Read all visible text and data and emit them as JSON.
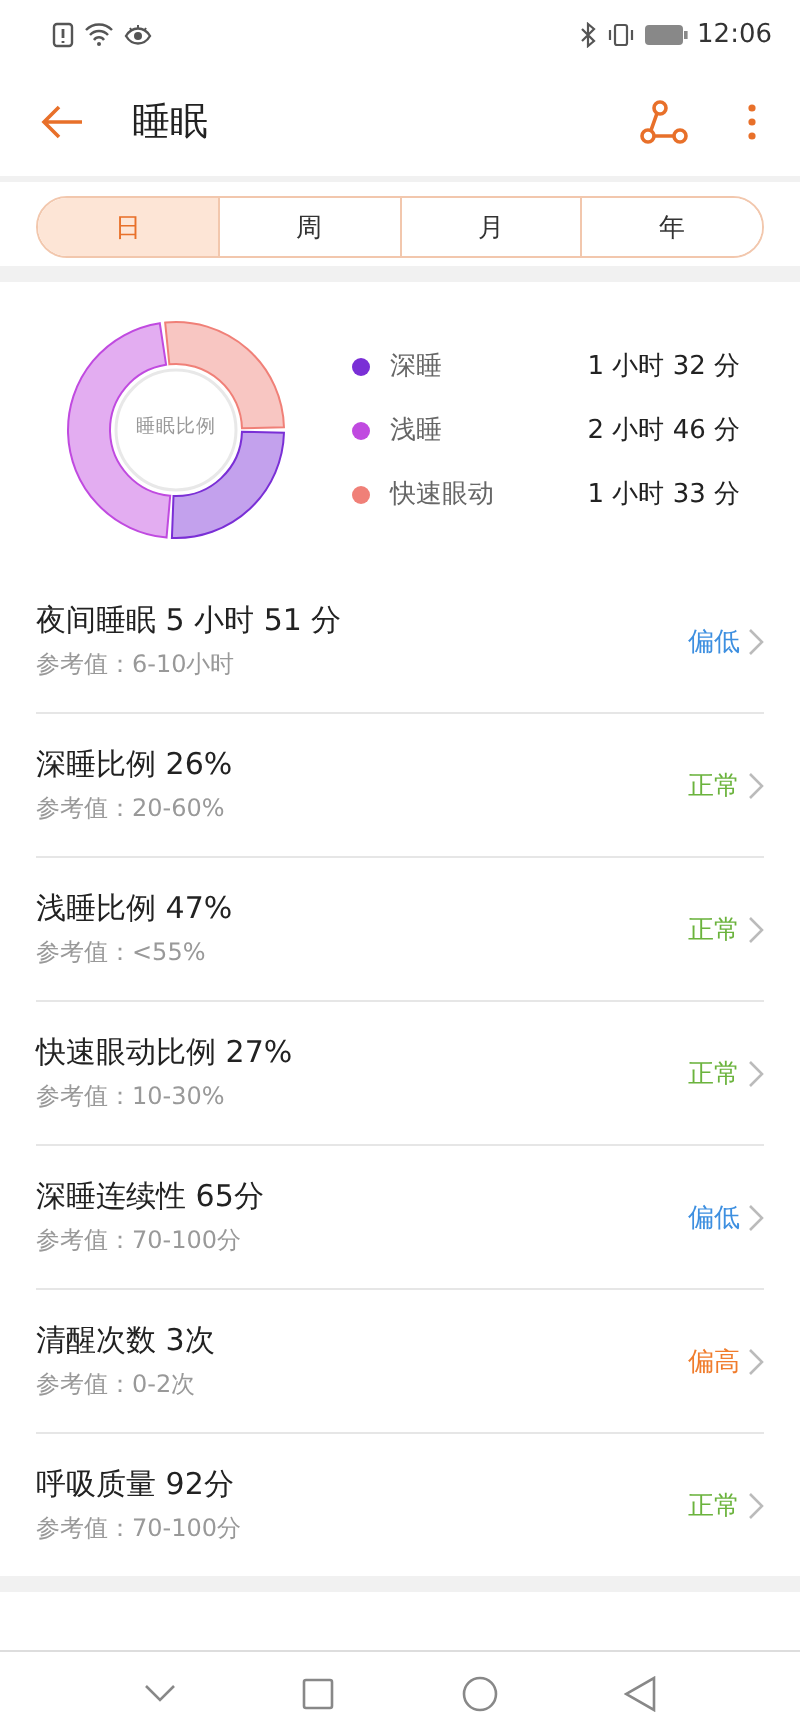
{
  "status_bar": {
    "time": "12:06"
  },
  "header": {
    "title": "睡眠"
  },
  "tabs": [
    {
      "label": "日",
      "selected": true
    },
    {
      "label": "周",
      "selected": false
    },
    {
      "label": "月",
      "selected": false
    },
    {
      "label": "年",
      "selected": false
    }
  ],
  "summary": {
    "chart_data": {
      "type": "donut",
      "title": "睡眠比例",
      "categories": [
        "深睡",
        "浅睡",
        "快速眼动"
      ],
      "series": [
        {
          "values": [
            26,
            47,
            27
          ]
        }
      ]
    },
    "legend": [
      {
        "value": "1 小时 32 分",
        "color": "#7a2fd6"
      },
      {
        "value": "2 小时 46 分",
        "color": "#c04ae0"
      },
      {
        "value": "1 小时 33 分",
        "color": "#f08078"
      }
    ]
  },
  "metrics": [
    {
      "name": "夜间睡眠",
      "value": "5 小时 51 分",
      "reference": "参考值：6-10小时",
      "status": "偏低",
      "kind": "low"
    },
    {
      "name": "深睡比例",
      "value": "26%",
      "reference": "参考值：20-60%",
      "status": "正常",
      "kind": "normal"
    },
    {
      "name": "浅睡比例",
      "value": "47%",
      "reference": "参考值：<55%",
      "status": "正常",
      "kind": "normal"
    },
    {
      "name": "快速眼动比例",
      "value": "27%",
      "reference": "参考值：10-30%",
      "status": "正常",
      "kind": "normal"
    },
    {
      "name": "深睡连续性",
      "value": "65分",
      "reference": "参考值：70-100分",
      "status": "偏低",
      "kind": "low"
    },
    {
      "name": "清醒次数",
      "value": "3次",
      "reference": "参考值：0-2次",
      "status": "偏高",
      "kind": "high"
    },
    {
      "name": "呼吸质量",
      "value": "92分",
      "reference": "参考值：70-100分",
      "status": "正常",
      "kind": "normal"
    }
  ]
}
